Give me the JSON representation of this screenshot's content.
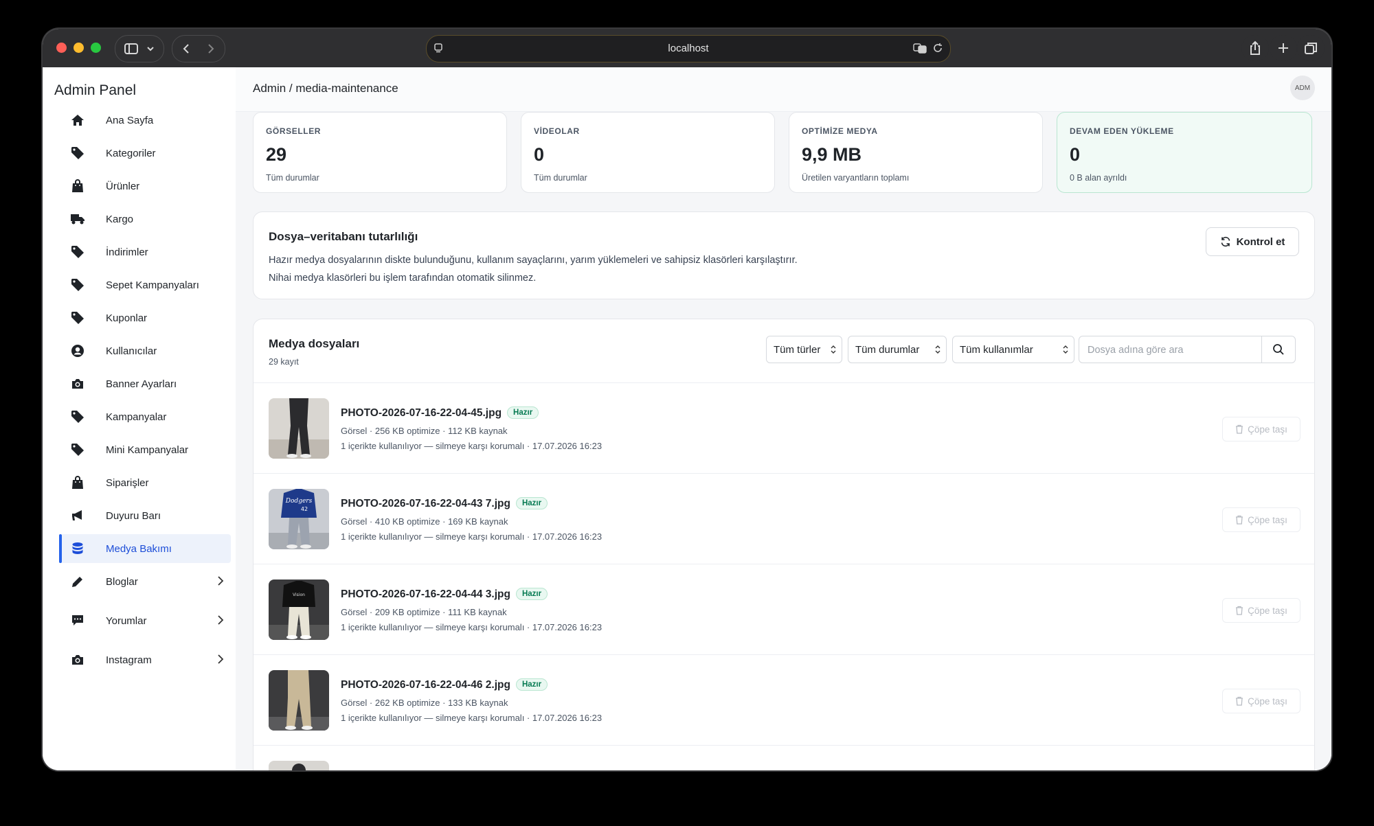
{
  "browser": {
    "url": "localhost"
  },
  "sidebar": {
    "brand": "Admin Panel",
    "items": [
      {
        "label": "Ana Sayfa",
        "icon": "home-icon"
      },
      {
        "label": "Kategoriler",
        "icon": "tag-icon"
      },
      {
        "label": "Ürünler",
        "icon": "shopping-bag-icon"
      },
      {
        "label": "Kargo",
        "icon": "truck-icon"
      },
      {
        "label": "İndirimler",
        "icon": "tag-icon"
      },
      {
        "label": "Sepet Kampanyaları",
        "icon": "tag-icon"
      },
      {
        "label": "Kuponlar",
        "icon": "tag-icon"
      },
      {
        "label": "Kullanıcılar",
        "icon": "user-circle-icon"
      },
      {
        "label": "Banner Ayarları",
        "icon": "camera-icon"
      },
      {
        "label": "Kampanyalar",
        "icon": "tag-icon"
      },
      {
        "label": "Mini Kampanyalar",
        "icon": "tag-icon"
      },
      {
        "label": "Siparişler",
        "icon": "shopping-bag-icon"
      },
      {
        "label": "Duyuru Barı",
        "icon": "megaphone-icon"
      },
      {
        "label": "Medya Bakımı",
        "icon": "database-icon",
        "active": true
      },
      {
        "label": "Bloglar",
        "icon": "pencil-icon",
        "expandable": true
      },
      {
        "label": "Yorumlar",
        "icon": "comment-icon",
        "expandable": true
      },
      {
        "label": "Instagram",
        "icon": "camera-icon",
        "expandable": true
      }
    ]
  },
  "header": {
    "breadcrumb": "Admin / media-maintenance",
    "avatar": "ADM"
  },
  "stats": [
    {
      "label": "GÖRSELLER",
      "value": "29",
      "sub": "Tüm durumlar"
    },
    {
      "label": "VİDEOLAR",
      "value": "0",
      "sub": "Tüm durumlar"
    },
    {
      "label": "OPTİMİZE MEDYA",
      "value": "9,9 MB",
      "sub": "Üretilen varyantların toplamı"
    },
    {
      "label": "DEVAM EDEN YÜKLEME",
      "value": "0",
      "sub": "0 B alan ayrıldı"
    }
  ],
  "integrity": {
    "title": "Dosya–veritabanı tutarlılığı",
    "line1": "Hazır medya dosyalarının diskte bulunduğunu, kullanım sayaçlarını, yarım yüklemeleri ve sahipsiz klasörleri karşılaştırır.",
    "line2": "Nihai medya klasörleri bu işlem tarafından otomatik silinmez.",
    "button": "Kontrol et"
  },
  "media": {
    "title": "Medya dosyaları",
    "count": "29 kayıt",
    "filters": {
      "type": "Tüm türler",
      "status": "Tüm durumlar",
      "usage": "Tüm kullanımlar"
    },
    "search_placeholder": "Dosya adına göre ara",
    "rows": [
      {
        "name": "PHOTO-2026-07-16-22-04-45.jpg",
        "badge": "Hazır",
        "meta1": "Görsel · 256 KB optimize · 112 KB kaynak",
        "meta2": "1 içerikte kullanılıyor — silmeye karşı korumalı · 17.07.2026 16:23",
        "action": "Çöpe taşı"
      },
      {
        "name": "PHOTO-2026-07-16-22-04-43 7.jpg",
        "badge": "Hazır",
        "meta1": "Görsel · 410 KB optimize · 169 KB kaynak",
        "meta2": "1 içerikte kullanılıyor — silmeye karşı korumalı · 17.07.2026 16:23",
        "action": "Çöpe taşı"
      },
      {
        "name": "PHOTO-2026-07-16-22-04-44 3.jpg",
        "badge": "Hazır",
        "meta1": "Görsel · 209 KB optimize · 111 KB kaynak",
        "meta2": "1 içerikte kullanılıyor — silmeye karşı korumalı · 17.07.2026 16:23",
        "action": "Çöpe taşı"
      },
      {
        "name": "PHOTO-2026-07-16-22-04-46 2.jpg",
        "badge": "Hazır",
        "meta1": "Görsel · 262 KB optimize · 133 KB kaynak",
        "meta2": "1 içerikte kullanılıyor — silmeye karşı korumalı · 17.07.2026 16:23",
        "action": "Çöpe taşı"
      }
    ]
  }
}
